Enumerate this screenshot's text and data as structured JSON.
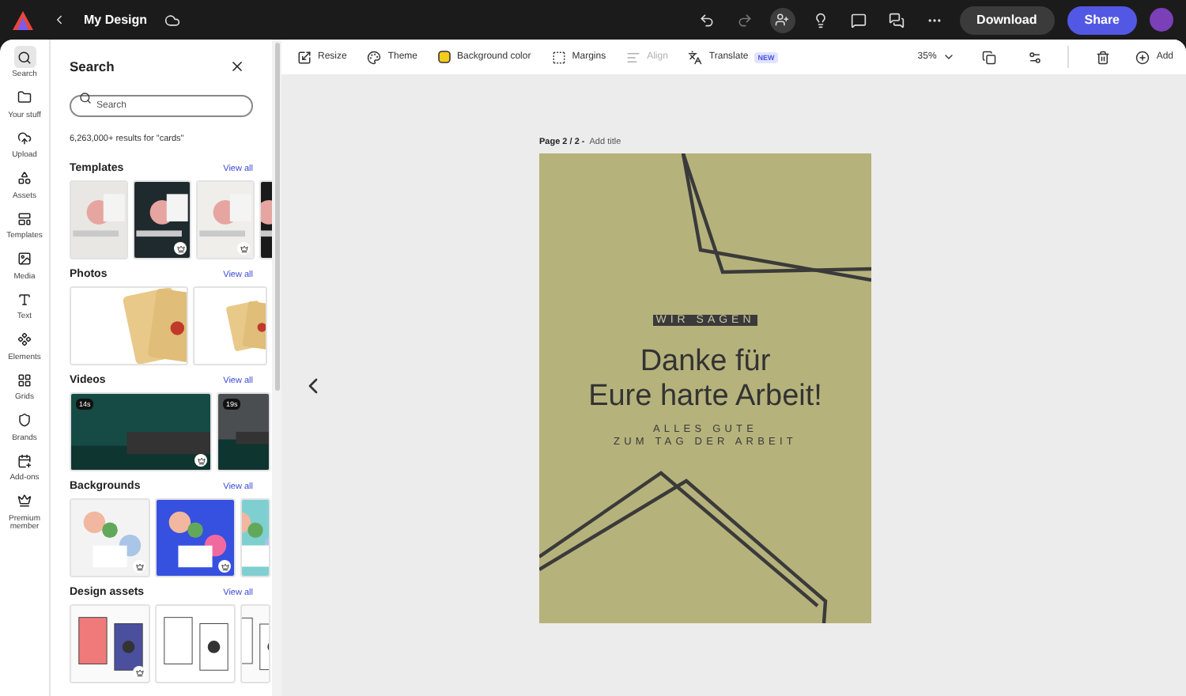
{
  "app_bar": {
    "title": "My Design",
    "download": "Download",
    "share": "Share"
  },
  "rail": [
    {
      "label": "Search",
      "selected": true
    },
    {
      "label": "Your stuff",
      "selected": false
    },
    {
      "label": "Upload",
      "selected": false
    },
    {
      "label": "Assets",
      "selected": false
    },
    {
      "label": "Templates",
      "selected": false
    },
    {
      "label": "Media",
      "selected": false
    },
    {
      "label": "Text",
      "selected": false
    },
    {
      "label": "Elements",
      "selected": false
    },
    {
      "label": "Grids",
      "selected": false
    },
    {
      "label": "Brands",
      "selected": false
    },
    {
      "label": "Add-ons",
      "selected": false
    },
    {
      "label": "Premium member",
      "selected": false
    }
  ],
  "panel": {
    "title": "Search",
    "search": {
      "placeholder": "Search"
    },
    "results": "6,263,000+ results for \"cards\"",
    "sections": [
      {
        "title": "Templates",
        "link": "View all",
        "items": [
          {
            "premium": false
          },
          {
            "premium": true
          },
          {
            "premium": true
          },
          {
            "premium": false
          }
        ]
      },
      {
        "title": "Photos",
        "link": "View all",
        "items": [
          {
            "premium": false
          },
          {
            "premium": false
          }
        ]
      },
      {
        "title": "Videos",
        "link": "View all",
        "items": [
          {
            "duration": "14s",
            "premium": true
          },
          {
            "duration": "19s",
            "premium": false
          }
        ]
      },
      {
        "title": "Backgrounds",
        "link": "View all",
        "items": [
          {
            "premium": true
          },
          {
            "premium": true
          },
          {
            "premium": false
          }
        ]
      },
      {
        "title": "Design assets",
        "link": "View all",
        "items": [
          {
            "premium": true
          },
          {
            "premium": false
          },
          {
            "premium": false
          }
        ]
      }
    ]
  },
  "toolbar": {
    "items": [
      {
        "label": "Resize",
        "disabled": false
      },
      {
        "label": "Theme",
        "disabled": false
      },
      {
        "label": "Background color",
        "disabled": false
      },
      {
        "label": "Margins",
        "disabled": false
      },
      {
        "label": "Align",
        "disabled": true
      },
      {
        "label": "Translate",
        "disabled": false,
        "badge": "NEW"
      }
    ],
    "zoom": "35%",
    "add": "Add"
  },
  "page": {
    "label": "Page 2 / 2 -",
    "add_title": "Add title",
    "tag": "WIR SAGEN",
    "headline": [
      "Danke für",
      "Eure harte Arbeit!"
    ],
    "subline": [
      "ALLES GUTE",
      "ZUM TAG DER ARBEIT"
    ]
  }
}
